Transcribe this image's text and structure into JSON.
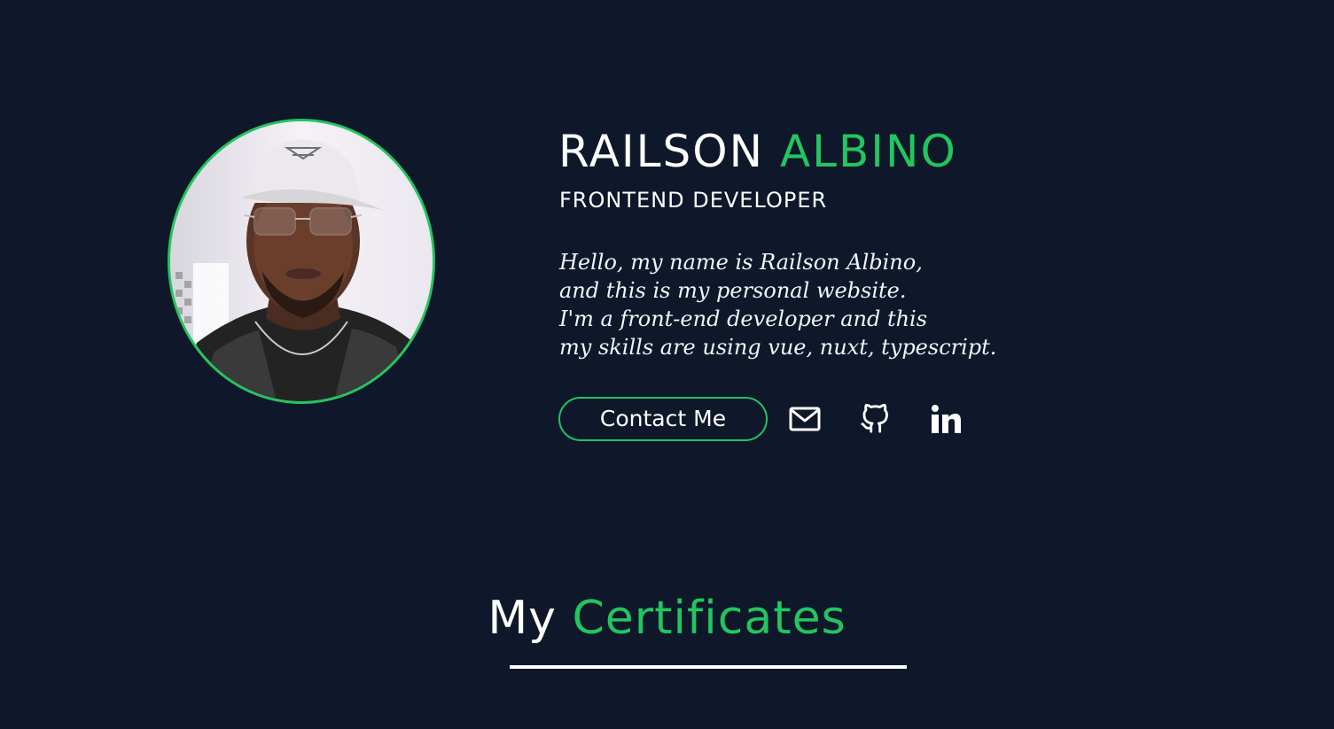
{
  "profile": {
    "first_name": "RAILSON",
    "last_name": "ALBINO",
    "role": "FRONTEND DEVELOPER",
    "bio_lines": [
      "Hello, my name is Railson Albino,",
      "and this is my personal website.",
      "I'm a front-end developer and this",
      "my skills are using vue, nuxt, typescript."
    ],
    "avatar_icon": "profile-photo"
  },
  "actions": {
    "contact_label": "Contact Me",
    "social_icons": [
      "mail-icon",
      "github-icon",
      "linkedin-icon"
    ]
  },
  "certificates": {
    "title_prefix": "My",
    "title_accent": "Certificates"
  },
  "theme": {
    "background": "#0f172a",
    "accent": "#22c55e",
    "text": "#ffffff"
  }
}
